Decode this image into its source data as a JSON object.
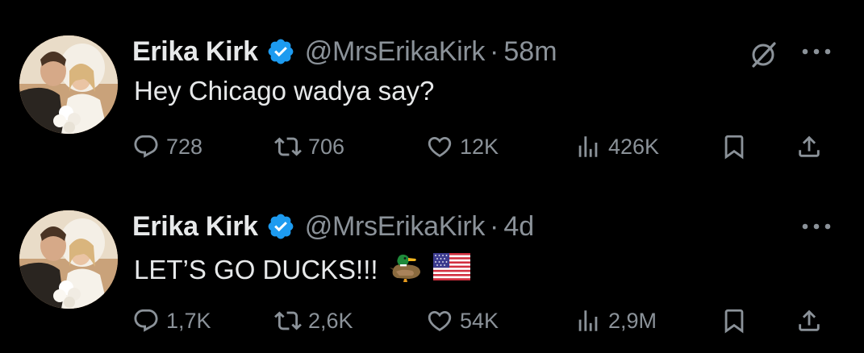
{
  "colors": {
    "background": "#000000",
    "text": "#e7e9ea",
    "muted": "#8b9299",
    "verified": "#1d9bf0"
  },
  "tweets": [
    {
      "name": "Erika Kirk",
      "handle": "@MrsErikaKirk",
      "separator": "·",
      "time": "58m",
      "text": "Hey Chicago wadya say?",
      "emojis": [],
      "show_grok": true,
      "counts": {
        "replies": "728",
        "reposts": "706",
        "likes": "12K",
        "views": "426K"
      }
    },
    {
      "name": "Erika Kirk",
      "handle": "@MrsErikaKirk",
      "separator": "·",
      "time": "4d",
      "text": "LET’S GO DUCKS!!!",
      "emojis": [
        "duck-emoji",
        "us-flag-emoji"
      ],
      "show_grok": false,
      "counts": {
        "replies": "1,7K",
        "reposts": "2,6K",
        "likes": "54K",
        "views": "2,9M"
      }
    }
  ],
  "icons": {
    "avatar": "avatar",
    "verified": "verified-badge-icon",
    "grok": "grok-icon",
    "more": "more-icon",
    "reply": "reply-icon",
    "repost": "repost-icon",
    "like": "like-icon",
    "views": "views-icon",
    "bookmark": "bookmark-icon",
    "share": "share-icon"
  }
}
